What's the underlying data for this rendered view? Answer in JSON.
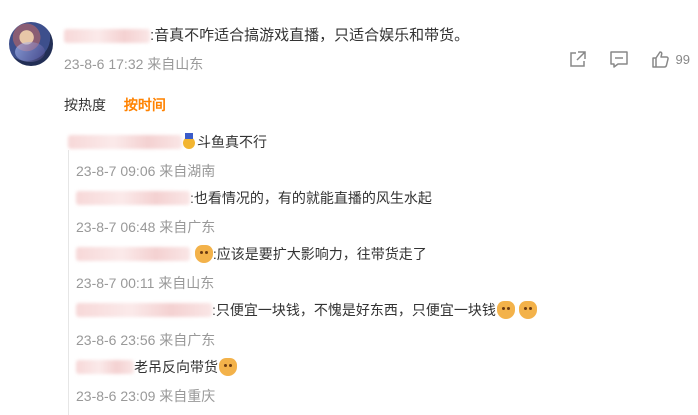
{
  "comment": {
    "text": ":音真不咋适合搞游戏直播，只适合娱乐和带货。",
    "time": "23-8-6 17:32",
    "location": "来自山东",
    "like_count": "99",
    "icons": [
      "share-icon",
      "comment-icon",
      "like-icon"
    ]
  },
  "sort_tabs": [
    {
      "label": "按热度",
      "active": false
    },
    {
      "label": "按时间",
      "active": true
    }
  ],
  "replies": [
    {
      "text": "斗鱼真不行",
      "time": "23-8-7 09:06",
      "location": "来自湖南"
    },
    {
      "text": ":也看情况的，有的就能直播的风生水起",
      "time": "23-8-7 06:48",
      "location": "来自广东"
    },
    {
      "text": ":应该是要扩大影响力，往带货走了",
      "time": "23-8-7 00:11",
      "location": "来自山东"
    },
    {
      "text": ":只便宜一块钱，不愧是好东西，只便宜一块钱",
      "time": "23-8-6 23:56",
      "location": "来自广东"
    },
    {
      "text": "老吊反向带货",
      "time": "23-8-6 23:09",
      "location": "来自重庆"
    }
  ],
  "colors": {
    "accent": "#ff8200",
    "meta": "#999999"
  }
}
